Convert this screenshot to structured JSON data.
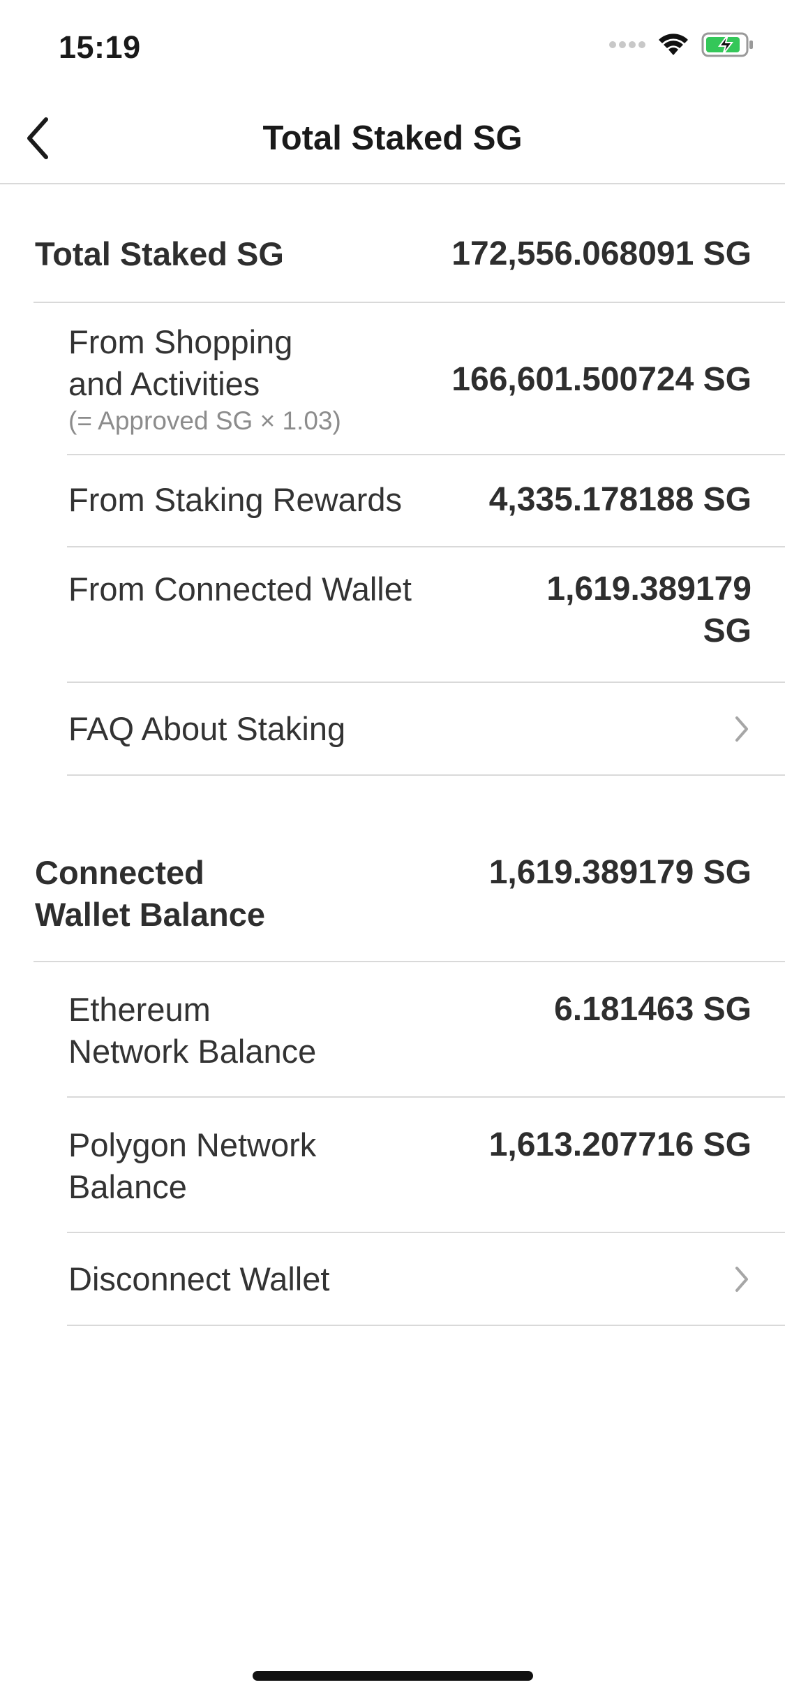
{
  "status_bar": {
    "time": "15:19",
    "icons": [
      "signal-dots-icon",
      "wifi-icon",
      "battery-charging-icon"
    ],
    "battery_color": "#34c759"
  },
  "nav": {
    "title": "Total Staked SG",
    "back_icon": "chevron-left-icon"
  },
  "total_staked": {
    "label": "Total Staked SG",
    "value": "172,556.068091 SG"
  },
  "shopping": {
    "label_line1": "From Shopping",
    "label_line2": "and Activities",
    "note": "(= Approved SG × 1.03)",
    "value": "166,601.500724 SG"
  },
  "rewards": {
    "label": "From Staking Rewards",
    "value": "4,335.178188 SG"
  },
  "connected_wallet": {
    "label": "From Connected Wallet",
    "value_line1": "1,619.389179",
    "value_line2": "SG"
  },
  "faq": {
    "label": "FAQ About Staking",
    "icon": "chevron-right-icon"
  },
  "wallet_balance": {
    "label_line1": "Connected",
    "label_line2": "Wallet Balance",
    "value": "1,619.389179 SG"
  },
  "ethereum": {
    "label_line1": "Ethereum",
    "label_line2": "Network Balance",
    "value": "6.181463 SG"
  },
  "polygon": {
    "label_line1": "Polygon Network",
    "label_line2": "Balance",
    "value": "1,613.207716 SG"
  },
  "disconnect": {
    "label": "Disconnect Wallet",
    "icon": "chevron-right-icon"
  }
}
